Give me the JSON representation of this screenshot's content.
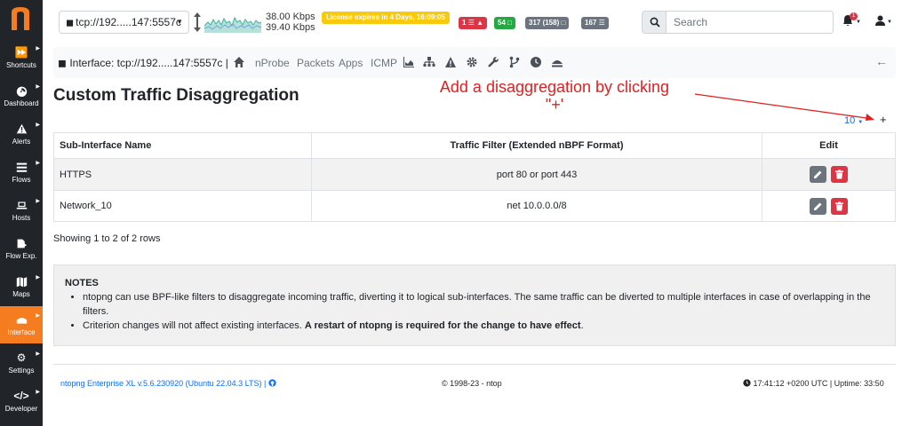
{
  "app": {
    "logo_letter": "n",
    "accent_color": "#f57d20"
  },
  "sidebar": {
    "items": [
      {
        "label": "Shortcuts",
        "icon": "fast-forward-icon"
      },
      {
        "label": "Dashboard",
        "icon": "gauge-icon"
      },
      {
        "label": "Alerts",
        "icon": "warning-icon"
      },
      {
        "label": "Flows",
        "icon": "list-icon"
      },
      {
        "label": "Hosts",
        "icon": "laptop-icon"
      },
      {
        "label": "Flow Exp.",
        "icon": "export-icon"
      },
      {
        "label": "Maps",
        "icon": "map-icon"
      },
      {
        "label": "Interface",
        "icon": "ethernet-icon",
        "active": true
      },
      {
        "label": "Settings",
        "icon": "gear-icon"
      },
      {
        "label": "Developer",
        "icon": "code-icon"
      }
    ]
  },
  "topbar": {
    "interface_select": "tcp://192.....147:5557c",
    "upload_speed": "38.00 Kbps",
    "download_speed": "39.40 Kbps",
    "license": "License expires in 4 Days, 16:09:05",
    "badges": {
      "alerts": "1",
      "hosts_green": "54",
      "devices": "317 (158)",
      "flows": "167"
    },
    "search_placeholder": "Search",
    "notification_count": "1"
  },
  "interface_nav": {
    "title": "Interface: tcp://192.....147:5557c",
    "separator": "|",
    "links": [
      "nProbe",
      "Packets",
      "Apps",
      "ICMP"
    ]
  },
  "page": {
    "title": "Custom Traffic Disaggregation",
    "annotation_line1": "Add a disaggregation by clicking",
    "annotation_line2": "\"+'",
    "page_size": "10",
    "add_label": "+"
  },
  "table": {
    "headers": [
      "Sub-Interface Name",
      "Traffic Filter (Extended nBPF Format)",
      "Edit"
    ],
    "rows": [
      {
        "name": "HTTPS",
        "filter": "port 80 or port 443"
      },
      {
        "name": "Network_10",
        "filter": "net 10.0.0.0/8"
      }
    ],
    "rows_info": "Showing 1 to 2 of 2 rows"
  },
  "notes": {
    "title": "NOTES",
    "item1": "ntopng can use BPF-like filters to disaggregate incoming traffic, diverting it to logical sub-interfaces. The same traffic can be diverted to multiple interfaces in case of overlapping in the filters.",
    "item2_plain": "Criterion changes will not affect existing interfaces. ",
    "item2_bold": "A restart of ntopng is required for the change to have effect",
    "item2_end": "."
  },
  "footer": {
    "version": "ntopng Enterprise XL v.5.6.230920 (Ubuntu 22.04.3 LTS) |",
    "copyright": "© 1998-23 - ntop",
    "clock": "17:41:12 +0200 UTC | Uptime: 33:50"
  }
}
